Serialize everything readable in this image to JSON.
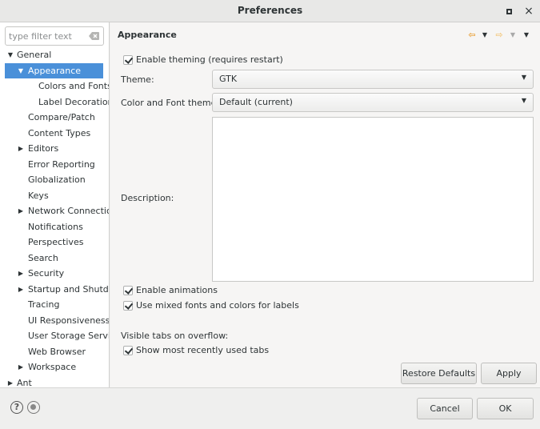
{
  "window": {
    "title": "Preferences",
    "maximize_glyph": "",
    "close_glyph": "×"
  },
  "filter": {
    "placeholder": "type filter text",
    "value": ""
  },
  "tree": [
    {
      "label": "General",
      "level": 0,
      "arrow": "▼",
      "selected": false
    },
    {
      "label": "Appearance",
      "level": 1,
      "arrow": "▼",
      "selected": true
    },
    {
      "label": "Colors and Fonts",
      "level": 2,
      "arrow": "",
      "selected": false
    },
    {
      "label": "Label Decorations",
      "level": 2,
      "arrow": "",
      "selected": false
    },
    {
      "label": "Compare/Patch",
      "level": 1,
      "arrow": "",
      "selected": false
    },
    {
      "label": "Content Types",
      "level": 1,
      "arrow": "",
      "selected": false
    },
    {
      "label": "Editors",
      "level": 1,
      "arrow": "▶",
      "selected": false
    },
    {
      "label": "Error Reporting",
      "level": 1,
      "arrow": "",
      "selected": false
    },
    {
      "label": "Globalization",
      "level": 1,
      "arrow": "",
      "selected": false
    },
    {
      "label": "Keys",
      "level": 1,
      "arrow": "",
      "selected": false
    },
    {
      "label": "Network Connections",
      "level": 1,
      "arrow": "▶",
      "selected": false
    },
    {
      "label": "Notifications",
      "level": 1,
      "arrow": "",
      "selected": false
    },
    {
      "label": "Perspectives",
      "level": 1,
      "arrow": "",
      "selected": false
    },
    {
      "label": "Search",
      "level": 1,
      "arrow": "",
      "selected": false
    },
    {
      "label": "Security",
      "level": 1,
      "arrow": "▶",
      "selected": false
    },
    {
      "label": "Startup and Shutdown",
      "level": 1,
      "arrow": "▶",
      "selected": false
    },
    {
      "label": "Tracing",
      "level": 1,
      "arrow": "",
      "selected": false
    },
    {
      "label": "UI Responsiveness",
      "level": 1,
      "arrow": "",
      "selected": false
    },
    {
      "label": "User Storage Service",
      "level": 1,
      "arrow": "",
      "selected": false
    },
    {
      "label": "Web Browser",
      "level": 1,
      "arrow": "",
      "selected": false
    },
    {
      "label": "Workspace",
      "level": 1,
      "arrow": "▶",
      "selected": false
    },
    {
      "label": "Ant",
      "level": 0,
      "arrow": "▶",
      "selected": false
    }
  ],
  "page": {
    "heading": "Appearance",
    "nav": {
      "back": "⇦",
      "forward": "⇨",
      "menu": "▼"
    },
    "enable_theming": {
      "label": "Enable theming (requires restart)",
      "checked": true
    },
    "theme": {
      "label": "Theme:",
      "value": "GTK"
    },
    "color_font_theme": {
      "label": "Color and Font theme:",
      "value": "Default (current)"
    },
    "description_label": "Description:",
    "description_text": "",
    "enable_animations": {
      "label": "Enable animations",
      "checked": true
    },
    "mixed_fonts": {
      "label": "Use mixed fonts and colors for labels",
      "checked": true
    },
    "visible_tabs_label": "Visible tabs on overflow:",
    "show_recent_tabs": {
      "label": "Show most recently used tabs",
      "checked": true
    },
    "restore_defaults": "Restore Defaults",
    "apply": "Apply"
  },
  "footer": {
    "help_glyph": "?",
    "cancel": "Cancel",
    "ok": "OK"
  },
  "colors": {
    "selection": "#4a90d9",
    "back_arrow": "#e8a33d"
  }
}
